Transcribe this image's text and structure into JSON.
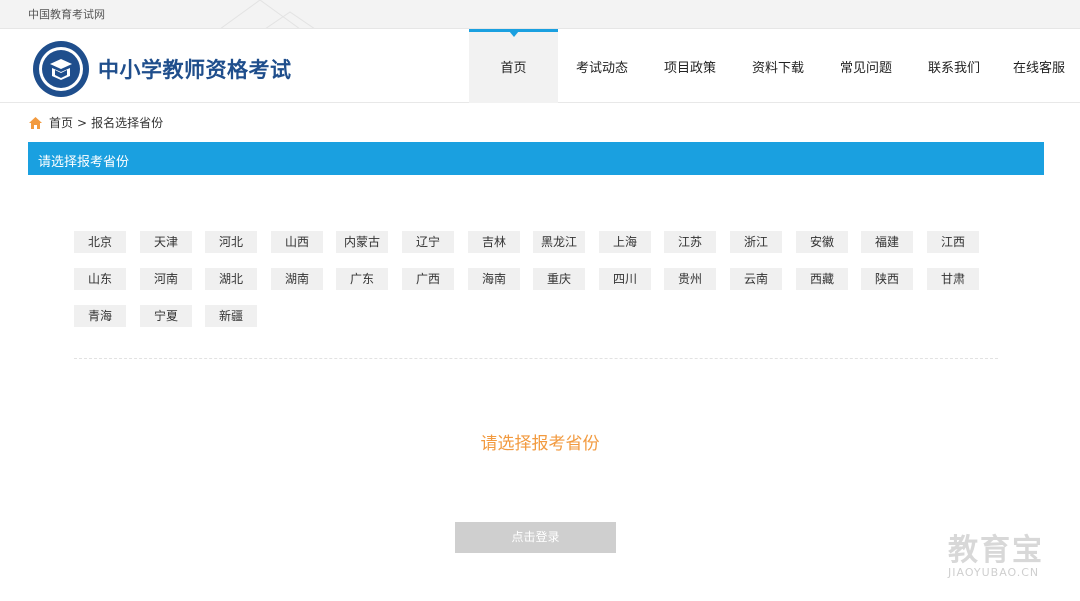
{
  "topbar": {
    "site_name": "中国教育考试网"
  },
  "header": {
    "title": "中小学教师资格考试"
  },
  "nav": {
    "items": [
      {
        "label": "首页",
        "active": true
      },
      {
        "label": "考试动态",
        "active": false
      },
      {
        "label": "项目政策",
        "active": false
      },
      {
        "label": "资料下载",
        "active": false
      },
      {
        "label": "常见问题",
        "active": false
      },
      {
        "label": "联系我们",
        "active": false
      },
      {
        "label": "在线客服",
        "active": false
      }
    ]
  },
  "breadcrumb": {
    "home": "首页",
    "separator": ">",
    "current": "报名选择省份"
  },
  "section": {
    "title": "请选择报考省份"
  },
  "provinces": [
    "北京",
    "天津",
    "河北",
    "山西",
    "内蒙古",
    "辽宁",
    "吉林",
    "黑龙江",
    "上海",
    "江苏",
    "浙江",
    "安徽",
    "福建",
    "江西",
    "山东",
    "河南",
    "湖北",
    "湖南",
    "广东",
    "广西",
    "海南",
    "重庆",
    "四川",
    "贵州",
    "云南",
    "西藏",
    "陕西",
    "甘肃",
    "青海",
    "宁夏",
    "新疆"
  ],
  "prompt": {
    "text": "请选择报考省份"
  },
  "login": {
    "label": "点击登录"
  },
  "watermark": {
    "cn": "教育宝",
    "en": "JIAOYUBAO.CN"
  },
  "colors": {
    "accent": "#1aa0e0",
    "prompt": "#f29a3f",
    "brand": "#1f4e8c"
  }
}
